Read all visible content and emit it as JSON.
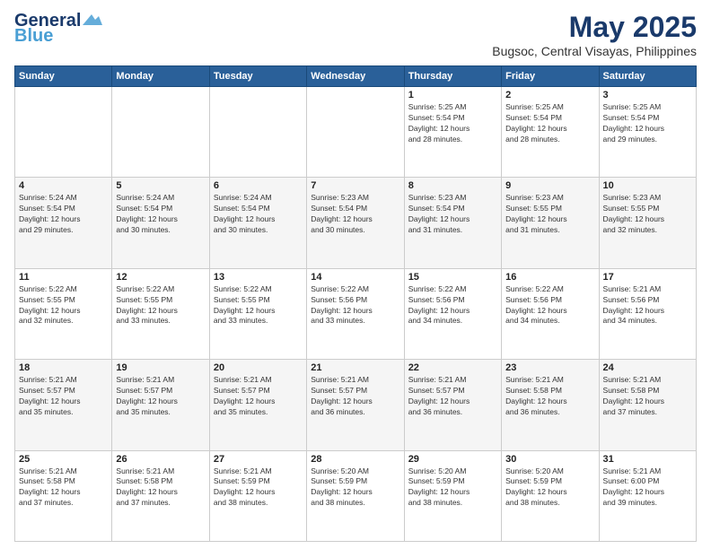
{
  "header": {
    "logo_line1": "General",
    "logo_line2": "Blue",
    "title": "May 2025",
    "subtitle": "Bugsoc, Central Visayas, Philippines"
  },
  "days_of_week": [
    "Sunday",
    "Monday",
    "Tuesday",
    "Wednesday",
    "Thursday",
    "Friday",
    "Saturday"
  ],
  "weeks": [
    [
      {
        "day": "",
        "info": ""
      },
      {
        "day": "",
        "info": ""
      },
      {
        "day": "",
        "info": ""
      },
      {
        "day": "",
        "info": ""
      },
      {
        "day": "1",
        "info": "Sunrise: 5:25 AM\nSunset: 5:54 PM\nDaylight: 12 hours\nand 28 minutes."
      },
      {
        "day": "2",
        "info": "Sunrise: 5:25 AM\nSunset: 5:54 PM\nDaylight: 12 hours\nand 28 minutes."
      },
      {
        "day": "3",
        "info": "Sunrise: 5:25 AM\nSunset: 5:54 PM\nDaylight: 12 hours\nand 29 minutes."
      }
    ],
    [
      {
        "day": "4",
        "info": "Sunrise: 5:24 AM\nSunset: 5:54 PM\nDaylight: 12 hours\nand 29 minutes."
      },
      {
        "day": "5",
        "info": "Sunrise: 5:24 AM\nSunset: 5:54 PM\nDaylight: 12 hours\nand 30 minutes."
      },
      {
        "day": "6",
        "info": "Sunrise: 5:24 AM\nSunset: 5:54 PM\nDaylight: 12 hours\nand 30 minutes."
      },
      {
        "day": "7",
        "info": "Sunrise: 5:23 AM\nSunset: 5:54 PM\nDaylight: 12 hours\nand 30 minutes."
      },
      {
        "day": "8",
        "info": "Sunrise: 5:23 AM\nSunset: 5:54 PM\nDaylight: 12 hours\nand 31 minutes."
      },
      {
        "day": "9",
        "info": "Sunrise: 5:23 AM\nSunset: 5:55 PM\nDaylight: 12 hours\nand 31 minutes."
      },
      {
        "day": "10",
        "info": "Sunrise: 5:23 AM\nSunset: 5:55 PM\nDaylight: 12 hours\nand 32 minutes."
      }
    ],
    [
      {
        "day": "11",
        "info": "Sunrise: 5:22 AM\nSunset: 5:55 PM\nDaylight: 12 hours\nand 32 minutes."
      },
      {
        "day": "12",
        "info": "Sunrise: 5:22 AM\nSunset: 5:55 PM\nDaylight: 12 hours\nand 33 minutes."
      },
      {
        "day": "13",
        "info": "Sunrise: 5:22 AM\nSunset: 5:55 PM\nDaylight: 12 hours\nand 33 minutes."
      },
      {
        "day": "14",
        "info": "Sunrise: 5:22 AM\nSunset: 5:56 PM\nDaylight: 12 hours\nand 33 minutes."
      },
      {
        "day": "15",
        "info": "Sunrise: 5:22 AM\nSunset: 5:56 PM\nDaylight: 12 hours\nand 34 minutes."
      },
      {
        "day": "16",
        "info": "Sunrise: 5:22 AM\nSunset: 5:56 PM\nDaylight: 12 hours\nand 34 minutes."
      },
      {
        "day": "17",
        "info": "Sunrise: 5:21 AM\nSunset: 5:56 PM\nDaylight: 12 hours\nand 34 minutes."
      }
    ],
    [
      {
        "day": "18",
        "info": "Sunrise: 5:21 AM\nSunset: 5:57 PM\nDaylight: 12 hours\nand 35 minutes."
      },
      {
        "day": "19",
        "info": "Sunrise: 5:21 AM\nSunset: 5:57 PM\nDaylight: 12 hours\nand 35 minutes."
      },
      {
        "day": "20",
        "info": "Sunrise: 5:21 AM\nSunset: 5:57 PM\nDaylight: 12 hours\nand 35 minutes."
      },
      {
        "day": "21",
        "info": "Sunrise: 5:21 AM\nSunset: 5:57 PM\nDaylight: 12 hours\nand 36 minutes."
      },
      {
        "day": "22",
        "info": "Sunrise: 5:21 AM\nSunset: 5:57 PM\nDaylight: 12 hours\nand 36 minutes."
      },
      {
        "day": "23",
        "info": "Sunrise: 5:21 AM\nSunset: 5:58 PM\nDaylight: 12 hours\nand 36 minutes."
      },
      {
        "day": "24",
        "info": "Sunrise: 5:21 AM\nSunset: 5:58 PM\nDaylight: 12 hours\nand 37 minutes."
      }
    ],
    [
      {
        "day": "25",
        "info": "Sunrise: 5:21 AM\nSunset: 5:58 PM\nDaylight: 12 hours\nand 37 minutes."
      },
      {
        "day": "26",
        "info": "Sunrise: 5:21 AM\nSunset: 5:58 PM\nDaylight: 12 hours\nand 37 minutes."
      },
      {
        "day": "27",
        "info": "Sunrise: 5:21 AM\nSunset: 5:59 PM\nDaylight: 12 hours\nand 38 minutes."
      },
      {
        "day": "28",
        "info": "Sunrise: 5:20 AM\nSunset: 5:59 PM\nDaylight: 12 hours\nand 38 minutes."
      },
      {
        "day": "29",
        "info": "Sunrise: 5:20 AM\nSunset: 5:59 PM\nDaylight: 12 hours\nand 38 minutes."
      },
      {
        "day": "30",
        "info": "Sunrise: 5:20 AM\nSunset: 5:59 PM\nDaylight: 12 hours\nand 38 minutes."
      },
      {
        "day": "31",
        "info": "Sunrise: 5:21 AM\nSunset: 6:00 PM\nDaylight: 12 hours\nand 39 minutes."
      }
    ]
  ]
}
